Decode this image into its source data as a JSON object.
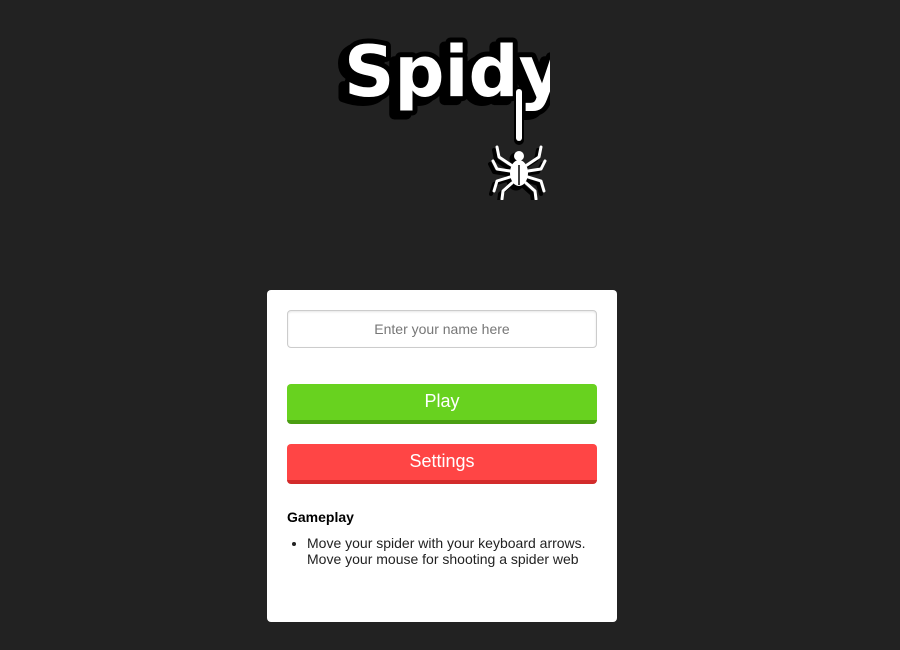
{
  "logo": {
    "text": "Spidy",
    "icon": "spider-icon"
  },
  "form": {
    "name_placeholder": "Enter your name here",
    "name_value": ""
  },
  "buttons": {
    "play_label": "Play",
    "settings_label": "Settings"
  },
  "gameplay": {
    "title": "Gameplay",
    "items": [
      "Move your spider with your keyboard arrows. Move your mouse for shooting a spider web"
    ]
  },
  "colors": {
    "background": "#222222",
    "play": "#68d21f",
    "settings": "#ff4545",
    "card": "#ffffff"
  }
}
